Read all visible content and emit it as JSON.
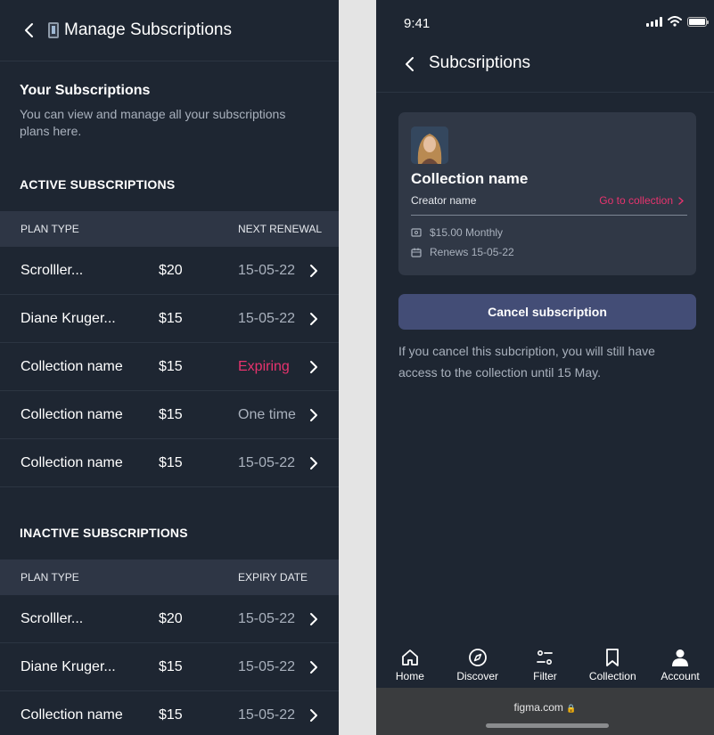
{
  "left": {
    "title": "Manage Subscriptions",
    "intro_heading": "Your Subscriptions",
    "intro_text": "You can view and manage all your subscriptions plans here.",
    "active": {
      "heading": "ACTIVE SUBSCRIPTIONS",
      "col_plan": "PLAN TYPE",
      "col_date": "NEXT RENEWAL",
      "rows": [
        {
          "name": "Scrolller...",
          "price": "$20",
          "date": "15-05-22"
        },
        {
          "name": "Diane Kruger...",
          "price": "$15",
          "date": "15-05-22"
        },
        {
          "name": "Collection name",
          "price": "$15",
          "date": "Expiring"
        },
        {
          "name": "Collection name",
          "price": "$15",
          "date": "One time"
        },
        {
          "name": "Collection name",
          "price": "$15",
          "date": "15-05-22"
        }
      ]
    },
    "inactive": {
      "heading": "INACTIVE SUBSCRIPTIONS",
      "col_plan": "PLAN TYPE",
      "col_date": "EXPIRY DATE",
      "rows": [
        {
          "name": "Scrolller...",
          "price": "$20",
          "date": "15-05-22"
        },
        {
          "name": "Diane Kruger...",
          "price": "$15",
          "date": "15-05-22"
        },
        {
          "name": "Collection name",
          "price": "$15",
          "date": "15-05-22"
        }
      ]
    }
  },
  "right": {
    "status_time": "9:41",
    "title": "Subcsriptions",
    "card": {
      "collection_name": "Collection name",
      "creator_name": "Creator name",
      "goto_label": "Go to collection",
      "price_line": "$15.00 Monthly",
      "renew_line": "Renews 15-05-22"
    },
    "cancel_label": "Cancel subscription",
    "note": "If you cancel this subcription, you will still have access to the collection until 15 May.",
    "tabs": [
      {
        "label": "Home",
        "icon": "home-icon"
      },
      {
        "label": "Discover",
        "icon": "compass-icon"
      },
      {
        "label": "Filter",
        "icon": "filter-icon"
      },
      {
        "label": "Collection",
        "icon": "bookmark-icon"
      },
      {
        "label": "Account",
        "icon": "user-icon"
      }
    ],
    "url": "figma.com"
  },
  "colors": {
    "background": "#1e2632",
    "accent_pink": "#e8336e",
    "button": "#434d76"
  }
}
